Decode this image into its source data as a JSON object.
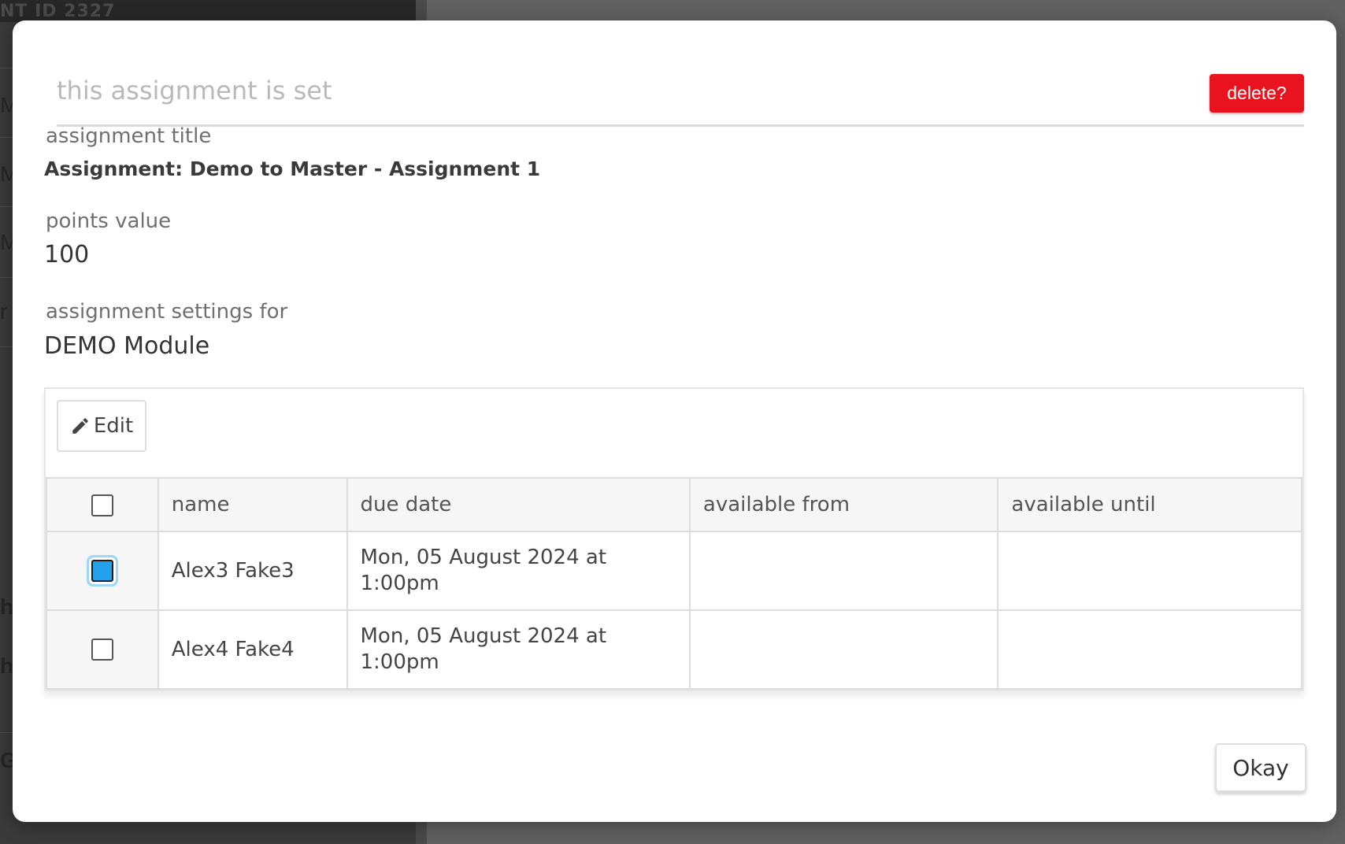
{
  "background": {
    "id_text": "NT ID  2327",
    "letters": [
      "M",
      "M",
      "M",
      "r",
      "h",
      "h",
      "G"
    ]
  },
  "modal": {
    "status_text": "this assignment is set",
    "delete_label": "delete?",
    "fields": {
      "title_label": "assignment title",
      "title_value": "Assignment: Demo to Master - Assignment 1",
      "points_label": "points value",
      "points_value": "100",
      "settings_label": "assignment settings for",
      "settings_value": "DEMO Module"
    },
    "panel": {
      "edit_label": "Edit",
      "columns": [
        "name",
        "due date",
        "available from",
        "available until"
      ],
      "rows": [
        {
          "name": "Alex3 Fake3",
          "due_date": "Mon, 05 August 2024 at 1:00pm",
          "available_from": "",
          "available_until": "",
          "checked": true
        },
        {
          "name": "Alex4 Fake4",
          "due_date": "Mon, 05 August 2024 at 1:00pm",
          "available_from": "",
          "available_until": "",
          "checked": false
        }
      ]
    },
    "okay_label": "Okay"
  },
  "colors": {
    "danger": "#e8131e",
    "checkbox_checked": "#22a0ea"
  },
  "icons": [
    "pencil-icon"
  ]
}
